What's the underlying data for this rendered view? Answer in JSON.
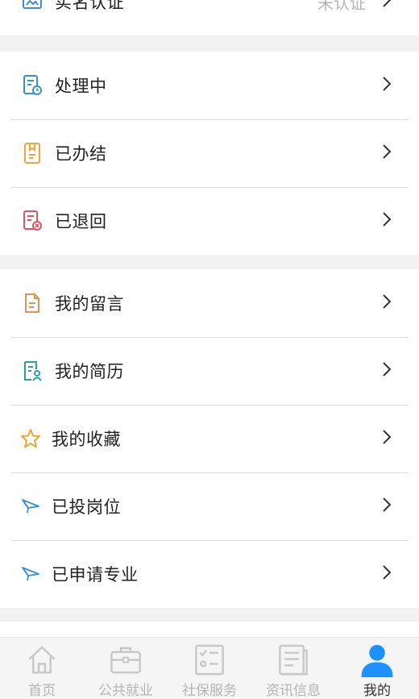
{
  "verify": {
    "label": "实名认证",
    "value": "未认证"
  },
  "status_section": {
    "items": [
      {
        "label": "处理中",
        "icon": "processing-document-icon",
        "color": "#3a8dd8"
      },
      {
        "label": "已办结",
        "icon": "completed-document-icon",
        "color": "#f0a43a"
      },
      {
        "label": "已退回",
        "icon": "returned-document-icon",
        "color": "#e0525e"
      }
    ]
  },
  "personal_section": {
    "items": [
      {
        "label": "我的留言",
        "icon": "message-document-icon",
        "color": "#d9965a"
      },
      {
        "label": "我的简历",
        "icon": "resume-icon",
        "color": "#2aa29a"
      },
      {
        "label": "我的收藏",
        "icon": "star-icon",
        "color": "#f0a43a"
      },
      {
        "label": "已投岗位",
        "icon": "paper-plane-icon",
        "color": "#3a8dd8"
      },
      {
        "label": "已申请专业",
        "icon": "paper-plane-icon",
        "color": "#3a8dd8"
      }
    ]
  },
  "tabbar": {
    "tabs": [
      {
        "label": "首页",
        "icon": "home-icon"
      },
      {
        "label": "公共就业",
        "icon": "briefcase-icon"
      },
      {
        "label": "社保服务",
        "icon": "checklist-icon"
      },
      {
        "label": "资讯信息",
        "icon": "news-icon"
      },
      {
        "label": "我的",
        "icon": "user-icon",
        "active": true
      }
    ],
    "active_color": "#1e90ff",
    "inactive_color": "#c8c8c8"
  }
}
